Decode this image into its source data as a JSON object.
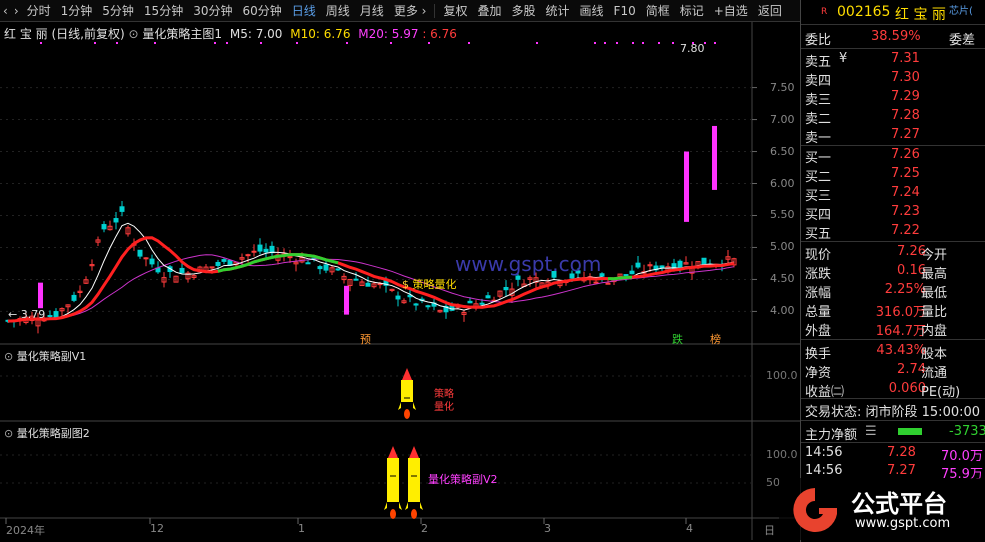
{
  "toolbar": {
    "nav_left_icon": "chevron-left-icon",
    "nav_right_icon": "chevron-right-icon",
    "periods": [
      "分时",
      "1分钟",
      "5分钟",
      "15分钟",
      "30分钟",
      "60分钟",
      "日线",
      "周线",
      "月线"
    ],
    "active_period": "日线",
    "more_label": "更多",
    "actions": [
      "复权",
      "叠加",
      "多股",
      "统计",
      "画线",
      "F10",
      "简框",
      "标记",
      "+自选",
      "返回"
    ]
  },
  "main_chart": {
    "header_name": "红 宝 丽",
    "header_mode": "(日线,前复权)",
    "indicator": "量化策略主图1",
    "ma5": "M5: 7.00",
    "ma10": "M10: 6.76",
    "ma20": "M20: 5.97",
    "ma20b": ": 6.76",
    "y_ticks": [
      "7.50",
      "7.00",
      "6.50",
      "6.00",
      "5.50",
      "5.00",
      "4.50",
      "4.00"
    ],
    "high_label": "7.80",
    "low_label": "3.79",
    "signal_label": "策略量化",
    "markers": [
      "预",
      "跌",
      "榜"
    ],
    "watermark": "www.gspt.com",
    "chart_data": {
      "type": "candlestick",
      "ylim": [
        3.6,
        7.9
      ],
      "y_ticks": [
        7.5,
        7.0,
        6.5,
        6.0,
        5.5,
        5.0,
        4.5,
        4.0
      ],
      "x_ticks": [
        "2024年",
        "12",
        "1",
        "2",
        "3",
        "4"
      ],
      "max_label": 7.8,
      "min_label": 3.79,
      "series": [
        {
          "name": "M5",
          "value": 7.0,
          "color": "#ffffff"
        },
        {
          "name": "M10",
          "value": 6.76,
          "color": "#ffdd00"
        },
        {
          "name": "M20",
          "value": 5.97,
          "color": "#ff40ff"
        }
      ]
    }
  },
  "sub1": {
    "title": "量化策略副V1",
    "tick": "100.0",
    "label1": "策略",
    "label2": "量化"
  },
  "sub2": {
    "title": "量化策略副图2",
    "tick1": "100.0",
    "tick2": "50",
    "label": "量化策略副V2"
  },
  "xaxis": {
    "labels": [
      "2024年",
      "12",
      "1",
      "2",
      "3",
      "4"
    ],
    "end": "日"
  },
  "quote": {
    "flag": "R",
    "code": "002165",
    "name": "红 宝 丽",
    "tag": "芯片(",
    "weibi_label": "委比",
    "weibi": "38.59%",
    "weicha_label": "委差",
    "sells": [
      {
        "l": "卖五",
        "p": "7.31",
        "flag": "¥"
      },
      {
        "l": "卖四",
        "p": "7.30"
      },
      {
        "l": "卖三",
        "p": "7.29"
      },
      {
        "l": "卖二",
        "p": "7.28"
      },
      {
        "l": "卖一",
        "p": "7.27"
      }
    ],
    "buys": [
      {
        "l": "买一",
        "p": "7.26"
      },
      {
        "l": "买二",
        "p": "7.25"
      },
      {
        "l": "买三",
        "p": "7.24"
      },
      {
        "l": "买四",
        "p": "7.23"
      },
      {
        "l": "买五",
        "p": "7.22"
      }
    ],
    "stats": [
      {
        "l": "现价",
        "v": "7.26",
        "r": "今开"
      },
      {
        "l": "涨跌",
        "v": "0.16",
        "r": "最高"
      },
      {
        "l": "涨幅",
        "v": "2.25%",
        "r": "最低"
      },
      {
        "l": "总量",
        "v": "316.0万",
        "r": "量比"
      },
      {
        "l": "外盘",
        "v": "164.7万",
        "r": "内盘"
      },
      {
        "l": "换手",
        "v": "43.43%",
        "r": "股本"
      },
      {
        "l": "净资",
        "v": "2.74",
        "r": "流通"
      },
      {
        "l": "收益㈡",
        "v": "0.060",
        "r": "PE(动)"
      }
    ],
    "trade_state": "交易状态: 闭市阶段 15:00:00",
    "main_flow_label": "主力净额",
    "main_flow_value": "-3733",
    "ticks": [
      {
        "t": "14:56",
        "p": "7.28",
        "v": "70.0万"
      },
      {
        "t": "14:56",
        "p": "7.27",
        "v": "75.9万"
      }
    ]
  },
  "logo": {
    "title": "公式平台",
    "url": "www.gspt.com"
  }
}
